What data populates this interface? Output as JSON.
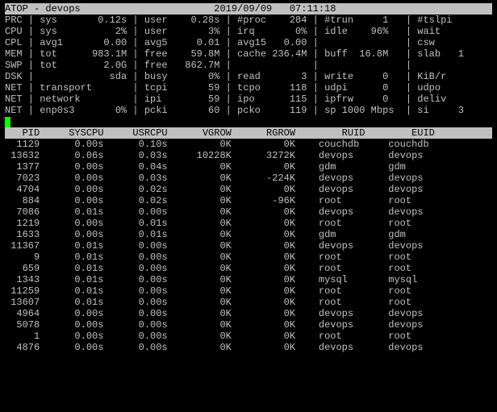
{
  "title": {
    "left": "ATOP - devops",
    "date": "2019/09/09",
    "time": "07:11:18"
  },
  "sys": [
    {
      "lbl": "PRC",
      "c1l": "sys",
      "c1v": "0.12s",
      "c2l": "user",
      "c2v": "0.28s",
      "c3l": "#proc",
      "c3v": "284",
      "c4l": "#trun",
      "c4v": "1",
      "c5l": "#tslpi",
      "c5v": ""
    },
    {
      "lbl": "CPU",
      "c1l": "sys",
      "c1v": "2%",
      "c2l": "user",
      "c2v": "3%",
      "c3l": "irq",
      "c3v": "0%",
      "c4l": "idle",
      "c4v": "96%",
      "c5l": "wait",
      "c5v": ""
    },
    {
      "lbl": "CPL",
      "c1l": "avg1",
      "c1v": "0.00",
      "c2l": "avg5",
      "c2v": "0.01",
      "c3l": "avg15",
      "c3v": "0.00",
      "c4l": "",
      "c4v": "",
      "c5l": "csw",
      "c5v": ""
    },
    {
      "lbl": "MEM",
      "c1l": "tot",
      "c1v": "983.1M",
      "c2l": "free",
      "c2v": "59.8M",
      "c3l": "cache",
      "c3v": "236.4M",
      "c4l": "buff",
      "c4v": "16.8M",
      "c5l": "slab",
      "c5v": "1"
    },
    {
      "lbl": "SWP",
      "c1l": "tot",
      "c1v": "2.0G",
      "c2l": "free",
      "c2v": "862.7M",
      "c3l": "",
      "c3v": "",
      "c4l": "",
      "c4v": "",
      "c5l": "",
      "c5v": ""
    },
    {
      "lbl": "DSK",
      "c1l": "",
      "c1v": "sda",
      "c2l": "busy",
      "c2v": "0%",
      "c3l": "read",
      "c3v": "3",
      "c4l": "write",
      "c4v": "0",
      "c5l": "KiB/r",
      "c5v": ""
    },
    {
      "lbl": "NET",
      "c1l": "transport",
      "c1v": "",
      "c2l": "tcpi",
      "c2v": "59",
      "c3l": "tcpo",
      "c3v": "118",
      "c4l": "udpi",
      "c4v": "0",
      "c5l": "udpo",
      "c5v": ""
    },
    {
      "lbl": "NET",
      "c1l": "network",
      "c1v": "",
      "c2l": "ipi",
      "c2v": "59",
      "c3l": "ipo",
      "c3v": "115",
      "c4l": "ipfrw",
      "c4v": "0",
      "c5l": "deliv",
      "c5v": ""
    },
    {
      "lbl": "NET",
      "c1l": "enp0s3",
      "c1v": "0%",
      "c2l": "pcki",
      "c2v": "60",
      "c3l": "pcko",
      "c3v": "119",
      "c4l": "sp 1000 Mbps",
      "c4v": "",
      "c5l": "si",
      "c5v": "3"
    }
  ],
  "cols": {
    "pid": "PID",
    "syscpu": "SYSCPU",
    "usrcpu": "USRCPU",
    "vgrow": "VGROW",
    "rgrow": "RGROW",
    "ruid": "RUID",
    "euid": "EUID"
  },
  "procs": [
    {
      "pid": "1129",
      "syscpu": "0.00s",
      "usrcpu": "0.10s",
      "vgrow": "0K",
      "rgrow": "0K",
      "ruid": "couchdb",
      "euid": "couchdb"
    },
    {
      "pid": "13632",
      "syscpu": "0.06s",
      "usrcpu": "0.03s",
      "vgrow": "10228K",
      "rgrow": "3272K",
      "ruid": "devops",
      "euid": "devops"
    },
    {
      "pid": "1377",
      "syscpu": "0.00s",
      "usrcpu": "0.04s",
      "vgrow": "0K",
      "rgrow": "0K",
      "ruid": "gdm",
      "euid": "gdm"
    },
    {
      "pid": "7023",
      "syscpu": "0.00s",
      "usrcpu": "0.03s",
      "vgrow": "0K",
      "rgrow": "-224K",
      "ruid": "devops",
      "euid": "devops"
    },
    {
      "pid": "4704",
      "syscpu": "0.00s",
      "usrcpu": "0.02s",
      "vgrow": "0K",
      "rgrow": "0K",
      "ruid": "devops",
      "euid": "devops"
    },
    {
      "pid": "884",
      "syscpu": "0.00s",
      "usrcpu": "0.02s",
      "vgrow": "0K",
      "rgrow": "-96K",
      "ruid": "root",
      "euid": "root"
    },
    {
      "pid": "7086",
      "syscpu": "0.01s",
      "usrcpu": "0.00s",
      "vgrow": "0K",
      "rgrow": "0K",
      "ruid": "devops",
      "euid": "devops"
    },
    {
      "pid": "1219",
      "syscpu": "0.00s",
      "usrcpu": "0.01s",
      "vgrow": "0K",
      "rgrow": "0K",
      "ruid": "root",
      "euid": "root"
    },
    {
      "pid": "1633",
      "syscpu": "0.00s",
      "usrcpu": "0.01s",
      "vgrow": "0K",
      "rgrow": "0K",
      "ruid": "gdm",
      "euid": "gdm"
    },
    {
      "pid": "11367",
      "syscpu": "0.01s",
      "usrcpu": "0.00s",
      "vgrow": "0K",
      "rgrow": "0K",
      "ruid": "devops",
      "euid": "devops"
    },
    {
      "pid": "9",
      "syscpu": "0.01s",
      "usrcpu": "0.00s",
      "vgrow": "0K",
      "rgrow": "0K",
      "ruid": "root",
      "euid": "root"
    },
    {
      "pid": "659",
      "syscpu": "0.01s",
      "usrcpu": "0.00s",
      "vgrow": "0K",
      "rgrow": "0K",
      "ruid": "root",
      "euid": "root"
    },
    {
      "pid": "1343",
      "syscpu": "0.01s",
      "usrcpu": "0.00s",
      "vgrow": "0K",
      "rgrow": "0K",
      "ruid": "mysql",
      "euid": "mysql"
    },
    {
      "pid": "11259",
      "syscpu": "0.01s",
      "usrcpu": "0.00s",
      "vgrow": "0K",
      "rgrow": "0K",
      "ruid": "root",
      "euid": "root"
    },
    {
      "pid": "13607",
      "syscpu": "0.01s",
      "usrcpu": "0.00s",
      "vgrow": "0K",
      "rgrow": "0K",
      "ruid": "root",
      "euid": "root"
    },
    {
      "pid": "4964",
      "syscpu": "0.00s",
      "usrcpu": "0.00s",
      "vgrow": "0K",
      "rgrow": "0K",
      "ruid": "devops",
      "euid": "devops"
    },
    {
      "pid": "5078",
      "syscpu": "0.00s",
      "usrcpu": "0.00s",
      "vgrow": "0K",
      "rgrow": "0K",
      "ruid": "devops",
      "euid": "devops"
    },
    {
      "pid": "1",
      "syscpu": "0.00s",
      "usrcpu": "0.00s",
      "vgrow": "0K",
      "rgrow": "0K",
      "ruid": "root",
      "euid": "root"
    },
    {
      "pid": "4876",
      "syscpu": "0.00s",
      "usrcpu": "0.00s",
      "vgrow": "0K",
      "rgrow": "0K",
      "ruid": "devops",
      "euid": "devops"
    }
  ]
}
